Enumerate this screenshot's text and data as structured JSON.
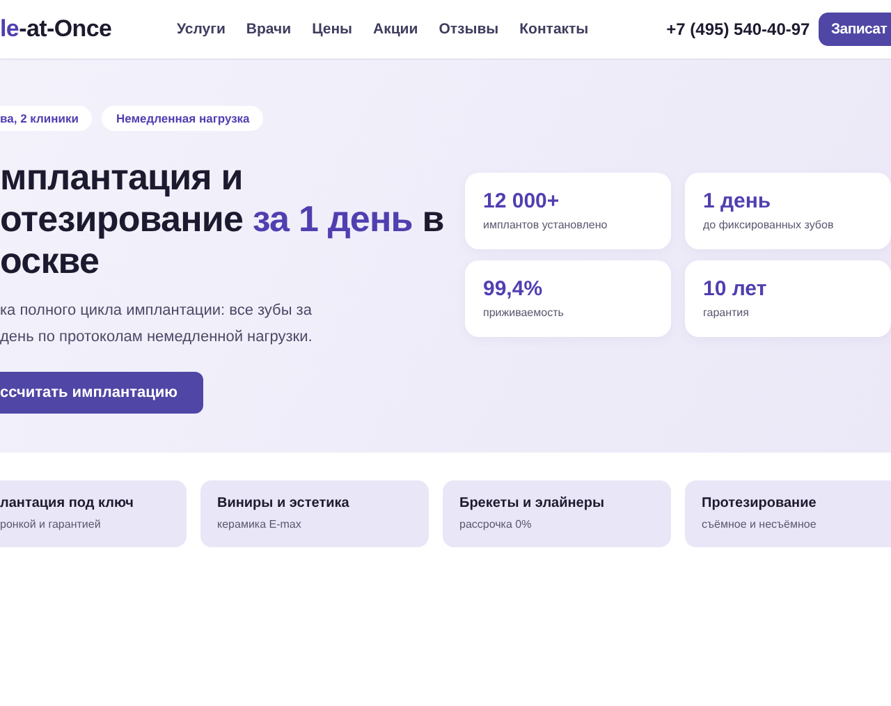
{
  "header": {
    "logo": [
      {
        "text": "le",
        "accent": true
      },
      {
        "text": "-at-Once",
        "accent": false
      }
    ],
    "nav": [
      "Услуги",
      "Врачи",
      "Цены",
      "Акции",
      "Отзывы",
      "Контакты"
    ],
    "phone": "+7 (495) 540-40-97",
    "cta": "Записат"
  },
  "hero": {
    "badges": [
      "ва, 2 клиники",
      "Немедленная нагрузка"
    ],
    "title_lines": [
      [
        {
          "text": "мплантация и",
          "accent": false
        }
      ],
      [
        {
          "text": "отезирование ",
          "accent": false
        },
        {
          "text": "за 1 день",
          "accent": true
        },
        {
          "text": " в",
          "accent": false
        }
      ],
      [
        {
          "text": "оскве",
          "accent": false
        }
      ]
    ],
    "subtitle": [
      "ка полного цикла имплантации: все зубы за",
      "день по протоколам немедленной нагрузки."
    ],
    "button": "ссчитать имплантацию",
    "stats": [
      {
        "value": "12 000+",
        "label": "имплантов установлено"
      },
      {
        "value": "1 день",
        "label": "до фиксированных зубов"
      },
      {
        "value": "99,4%",
        "label": "приживаемость"
      },
      {
        "value": "10 лет",
        "label": "гарантия"
      }
    ]
  },
  "services": [
    {
      "title": "лантация под ключ",
      "note": "ронкой и гарантией"
    },
    {
      "title": "Виниры и эстетика",
      "note": "керамика E-max"
    },
    {
      "title": "Брекеты и элайнеры",
      "note": "рассрочка 0%"
    },
    {
      "title": "Протезирование",
      "note": "съёмное и несъёмное"
    }
  ]
}
